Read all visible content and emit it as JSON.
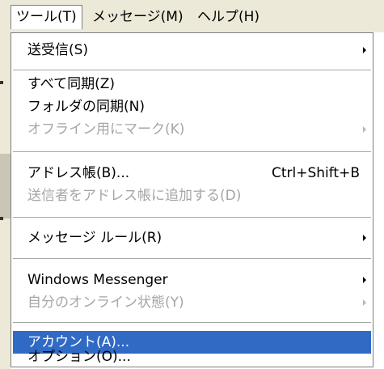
{
  "menubar": {
    "tools": "ツール(T)",
    "message": "メッセージ(M)",
    "help": "ヘルプ(H)"
  },
  "menu": {
    "send_receive": "送受信(S)",
    "sync_all": "すべて同期(Z)",
    "sync_folder": "フォルダの同期(N)",
    "mark_offline": "オフライン用にマーク(K)",
    "address_book": "アドレス帳(B)...",
    "address_book_shortcut": "Ctrl+Shift+B",
    "add_sender": "送信者をアドレス帳に追加する(D)",
    "message_rules": "メッセージ ルール(R)",
    "windows_messenger": "Windows Messenger",
    "my_online_status": "自分のオンライン状態(Y)",
    "accounts": "アカウント(A)...",
    "options": "オプション(O)..."
  },
  "colors": {
    "highlight": "#316ac5",
    "disabled_text": "#a6a6a6",
    "menubar_bg": "#ece9d8"
  }
}
